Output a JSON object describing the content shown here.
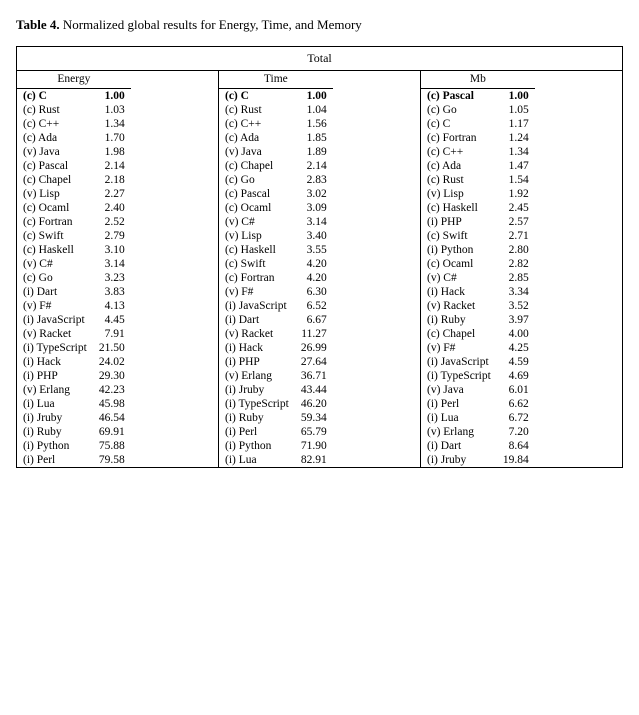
{
  "title": {
    "prefix": "Table 4.",
    "suffix": " Normalized global results for Energy, Time, and Memory"
  },
  "total_label": "Total",
  "energy": {
    "header": "Energy",
    "rows": [
      {
        "lang": "(c) C",
        "val": "1.00",
        "bold": true
      },
      {
        "lang": "(c) Rust",
        "val": "1.03",
        "bold": false
      },
      {
        "lang": "(c) C++",
        "val": "1.34",
        "bold": false
      },
      {
        "lang": "(c) Ada",
        "val": "1.70",
        "bold": false
      },
      {
        "lang": "(v) Java",
        "val": "1.98",
        "bold": false
      },
      {
        "lang": "(c) Pascal",
        "val": "2.14",
        "bold": false
      },
      {
        "lang": "(c) Chapel",
        "val": "2.18",
        "bold": false
      },
      {
        "lang": "(v) Lisp",
        "val": "2.27",
        "bold": false
      },
      {
        "lang": "(c) Ocaml",
        "val": "2.40",
        "bold": false
      },
      {
        "lang": "(c) Fortran",
        "val": "2.52",
        "bold": false
      },
      {
        "lang": "(c) Swift",
        "val": "2.79",
        "bold": false
      },
      {
        "lang": "(c) Haskell",
        "val": "3.10",
        "bold": false
      },
      {
        "lang": "(v) C#",
        "val": "3.14",
        "bold": false
      },
      {
        "lang": "(c) Go",
        "val": "3.23",
        "bold": false
      },
      {
        "lang": "(i) Dart",
        "val": "3.83",
        "bold": false
      },
      {
        "lang": "(v) F#",
        "val": "4.13",
        "bold": false
      },
      {
        "lang": "(i) JavaScript",
        "val": "4.45",
        "bold": false
      },
      {
        "lang": "(v) Racket",
        "val": "7.91",
        "bold": false
      },
      {
        "lang": "(i) TypeScript",
        "val": "21.50",
        "bold": false
      },
      {
        "lang": "(i) Hack",
        "val": "24.02",
        "bold": false
      },
      {
        "lang": "(i) PHP",
        "val": "29.30",
        "bold": false
      },
      {
        "lang": "(v) Erlang",
        "val": "42.23",
        "bold": false
      },
      {
        "lang": "(i) Lua",
        "val": "45.98",
        "bold": false
      },
      {
        "lang": "(i) Jruby",
        "val": "46.54",
        "bold": false
      },
      {
        "lang": "(i) Ruby",
        "val": "69.91",
        "bold": false
      },
      {
        "lang": "(i) Python",
        "val": "75.88",
        "bold": false
      },
      {
        "lang": "(i) Perl",
        "val": "79.58",
        "bold": false
      }
    ]
  },
  "time": {
    "header": "Time",
    "rows": [
      {
        "lang": "(c) C",
        "val": "1.00",
        "bold": true
      },
      {
        "lang": "(c) Rust",
        "val": "1.04",
        "bold": false
      },
      {
        "lang": "(c) C++",
        "val": "1.56",
        "bold": false
      },
      {
        "lang": "(c) Ada",
        "val": "1.85",
        "bold": false
      },
      {
        "lang": "(v) Java",
        "val": "1.89",
        "bold": false
      },
      {
        "lang": "(c) Chapel",
        "val": "2.14",
        "bold": false
      },
      {
        "lang": "(c) Go",
        "val": "2.83",
        "bold": false
      },
      {
        "lang": "(c) Pascal",
        "val": "3.02",
        "bold": false
      },
      {
        "lang": "(c) Ocaml",
        "val": "3.09",
        "bold": false
      },
      {
        "lang": "(v) C#",
        "val": "3.14",
        "bold": false
      },
      {
        "lang": "(v) Lisp",
        "val": "3.40",
        "bold": false
      },
      {
        "lang": "(c) Haskell",
        "val": "3.55",
        "bold": false
      },
      {
        "lang": "(c) Swift",
        "val": "4.20",
        "bold": false
      },
      {
        "lang": "(c) Fortran",
        "val": "4.20",
        "bold": false
      },
      {
        "lang": "(v) F#",
        "val": "6.30",
        "bold": false
      },
      {
        "lang": "(i) JavaScript",
        "val": "6.52",
        "bold": false
      },
      {
        "lang": "(i) Dart",
        "val": "6.67",
        "bold": false
      },
      {
        "lang": "(v) Racket",
        "val": "11.27",
        "bold": false
      },
      {
        "lang": "(i) Hack",
        "val": "26.99",
        "bold": false
      },
      {
        "lang": "(i) PHP",
        "val": "27.64",
        "bold": false
      },
      {
        "lang": "(v) Erlang",
        "val": "36.71",
        "bold": false
      },
      {
        "lang": "(i) Jruby",
        "val": "43.44",
        "bold": false
      },
      {
        "lang": "(i) TypeScript",
        "val": "46.20",
        "bold": false
      },
      {
        "lang": "(i) Ruby",
        "val": "59.34",
        "bold": false
      },
      {
        "lang": "(i) Perl",
        "val": "65.79",
        "bold": false
      },
      {
        "lang": "(i) Python",
        "val": "71.90",
        "bold": false
      },
      {
        "lang": "(i) Lua",
        "val": "82.91",
        "bold": false
      }
    ]
  },
  "memory": {
    "header": "Mb",
    "rows": [
      {
        "lang": "(c) Pascal",
        "val": "1.00",
        "bold": true
      },
      {
        "lang": "(c) Go",
        "val": "1.05",
        "bold": false
      },
      {
        "lang": "(c) C",
        "val": "1.17",
        "bold": false
      },
      {
        "lang": "(c) Fortran",
        "val": "1.24",
        "bold": false
      },
      {
        "lang": "(c) C++",
        "val": "1.34",
        "bold": false
      },
      {
        "lang": "(c) Ada",
        "val": "1.47",
        "bold": false
      },
      {
        "lang": "(c) Rust",
        "val": "1.54",
        "bold": false
      },
      {
        "lang": "(v) Lisp",
        "val": "1.92",
        "bold": false
      },
      {
        "lang": "(c) Haskell",
        "val": "2.45",
        "bold": false
      },
      {
        "lang": "(i) PHP",
        "val": "2.57",
        "bold": false
      },
      {
        "lang": "(c) Swift",
        "val": "2.71",
        "bold": false
      },
      {
        "lang": "(i) Python",
        "val": "2.80",
        "bold": false
      },
      {
        "lang": "(c) Ocaml",
        "val": "2.82",
        "bold": false
      },
      {
        "lang": "(v) C#",
        "val": "2.85",
        "bold": false
      },
      {
        "lang": "(i) Hack",
        "val": "3.34",
        "bold": false
      },
      {
        "lang": "(v) Racket",
        "val": "3.52",
        "bold": false
      },
      {
        "lang": "(i) Ruby",
        "val": "3.97",
        "bold": false
      },
      {
        "lang": "(c) Chapel",
        "val": "4.00",
        "bold": false
      },
      {
        "lang": "(v) F#",
        "val": "4.25",
        "bold": false
      },
      {
        "lang": "(i) JavaScript",
        "val": "4.59",
        "bold": false
      },
      {
        "lang": "(i) TypeScript",
        "val": "4.69",
        "bold": false
      },
      {
        "lang": "(v) Java",
        "val": "6.01",
        "bold": false
      },
      {
        "lang": "(i) Perl",
        "val": "6.62",
        "bold": false
      },
      {
        "lang": "(i) Lua",
        "val": "6.72",
        "bold": false
      },
      {
        "lang": "(v) Erlang",
        "val": "7.20",
        "bold": false
      },
      {
        "lang": "(i) Dart",
        "val": "8.64",
        "bold": false
      },
      {
        "lang": "(i) Jruby",
        "val": "19.84",
        "bold": false
      }
    ]
  }
}
